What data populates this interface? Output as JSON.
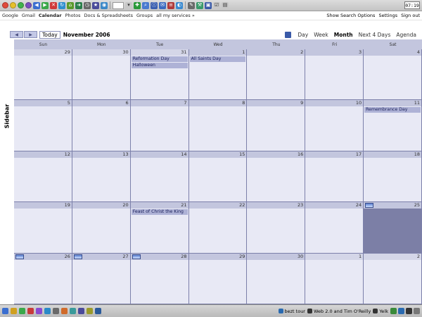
{
  "browser": {
    "clock": "07:19",
    "toolbar_icons": [
      "red-close",
      "yellow-minimize",
      "green-zoom",
      "back",
      "forward",
      "reload",
      "stop",
      "home",
      "bookmarks",
      "search",
      "print",
      "mail",
      "addons",
      "tools",
      "prefs",
      "downloads",
      "history",
      "settings"
    ]
  },
  "gbar": {
    "links": [
      "Google",
      "Gmail",
      "Calendar",
      "Photos",
      "Docs & Spreadsheets",
      "Groups",
      "all my services »"
    ],
    "active": "Calendar",
    "right_links": [
      "Show Search Options",
      "Settings",
      "Sign out"
    ]
  },
  "calendar": {
    "today_label": "Today",
    "month_title": "November 2006",
    "views": [
      "Day",
      "Week",
      "Month",
      "Next 4 Days",
      "Agenda"
    ],
    "active_view": "Month",
    "sidebar_label": "Sidebar",
    "days_of_week": [
      "Sun",
      "Mon",
      "Tue",
      "Wed",
      "Thu",
      "Fri",
      "Sat"
    ],
    "weeks": [
      [
        {
          "d": "29",
          "o": true
        },
        {
          "d": "30",
          "o": true
        },
        {
          "d": "31",
          "o": true,
          "events": [
            "Reformation Day",
            "Halloween"
          ]
        },
        {
          "d": "1",
          "events": [
            "All Saints Day"
          ]
        },
        {
          "d": "2"
        },
        {
          "d": "3"
        },
        {
          "d": "4"
        }
      ],
      [
        {
          "d": "5"
        },
        {
          "d": "6"
        },
        {
          "d": "7"
        },
        {
          "d": "8"
        },
        {
          "d": "9"
        },
        {
          "d": "10"
        },
        {
          "d": "11",
          "events": [
            "Remembrance Day"
          ]
        }
      ],
      [
        {
          "d": "12"
        },
        {
          "d": "13"
        },
        {
          "d": "14"
        },
        {
          "d": "15"
        },
        {
          "d": "16"
        },
        {
          "d": "17"
        },
        {
          "d": "18"
        }
      ],
      [
        {
          "d": "19"
        },
        {
          "d": "20"
        },
        {
          "d": "21",
          "events": [
            "Feast of Christ the King"
          ]
        },
        {
          "d": "22"
        },
        {
          "d": "23"
        },
        {
          "d": "24"
        },
        {
          "d": "25",
          "sel": true,
          "moon": true
        }
      ],
      [
        {
          "d": "26",
          "moon": true
        },
        {
          "d": "27",
          "moon": true
        },
        {
          "d": "28",
          "moon": true
        },
        {
          "d": "29"
        },
        {
          "d": "30"
        },
        {
          "d": "1",
          "o": true
        },
        {
          "d": "2",
          "o": true
        }
      ]
    ]
  },
  "taskbar": {
    "items": [
      "bezt tour",
      "Web 2.0 and Tim O'Reilly",
      "Yelk"
    ]
  }
}
